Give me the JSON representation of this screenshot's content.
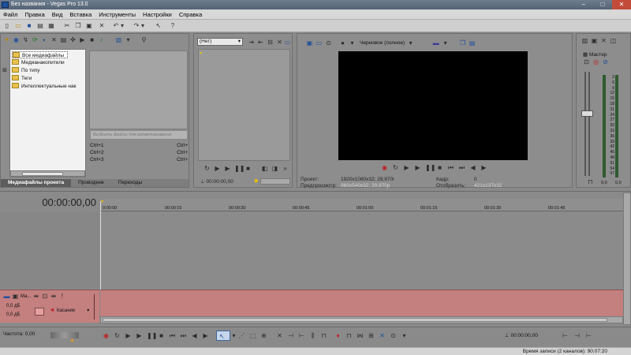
{
  "window": {
    "title": "Без названия - Vegas Pro 13.0"
  },
  "menu": [
    "Файл",
    "Правка",
    "Вид",
    "Вставка",
    "Инструменты",
    "Настройки",
    "Справка"
  ],
  "media_panel": {
    "tree": [
      "Все медиафайлы",
      "Медианакопители",
      "По типу",
      "Теги",
      "Интеллектуальные нак"
    ],
    "search_placeholder": "Выбрать файлы для редактирования",
    "shortcuts": [
      {
        "name": "Ctrl+1",
        "key": "Ctrl+"
      },
      {
        "name": "Ctrl+2",
        "key": "Ctrl+"
      },
      {
        "name": "Ctrl+3",
        "key": "Ctrl+"
      }
    ],
    "tabs": [
      "Медиафайлы проекта",
      "Проводник",
      "Переходы"
    ]
  },
  "trimmer": {
    "select_value": "(Нет)",
    "time": "00:00:00,00"
  },
  "preview": {
    "quality": "Черновое (полное)",
    "project_label": "Проект:",
    "project_value": "1920x1080x32; 29,970i",
    "preview_label": "Предпросмотр:",
    "preview_value": "960x540x32; 29,970p",
    "frame_label": "Кадр:",
    "frame_value": "0",
    "display_label": "Отобразить:",
    "display_value": "421x237x32"
  },
  "master": {
    "title": "Мастер",
    "scale": [
      "3",
      "6",
      "9",
      "12",
      "15",
      "18",
      "21",
      "24",
      "27",
      "30",
      "33",
      "36",
      "39",
      "42",
      "45",
      "48",
      "51",
      "54",
      "57"
    ],
    "left_level": "0,0",
    "right_level": "0,0"
  },
  "timeline": {
    "time": "00:00:00,00",
    "ruler": [
      "0:00:00",
      "00:00:15",
      "00:00:30",
      "00:00:45",
      "00:01:00",
      "00:01:15",
      "00:01:30",
      "00:01:45"
    ]
  },
  "track": {
    "name": "Ма...",
    "volume": "0,0 дБ",
    "pan": "0,0 дБ",
    "mode": "Касание"
  },
  "status": {
    "rate": "Частота: 0,00",
    "time": "00:00:00,00",
    "record_time": "Время записи (2 каналов): 90:07:20"
  }
}
